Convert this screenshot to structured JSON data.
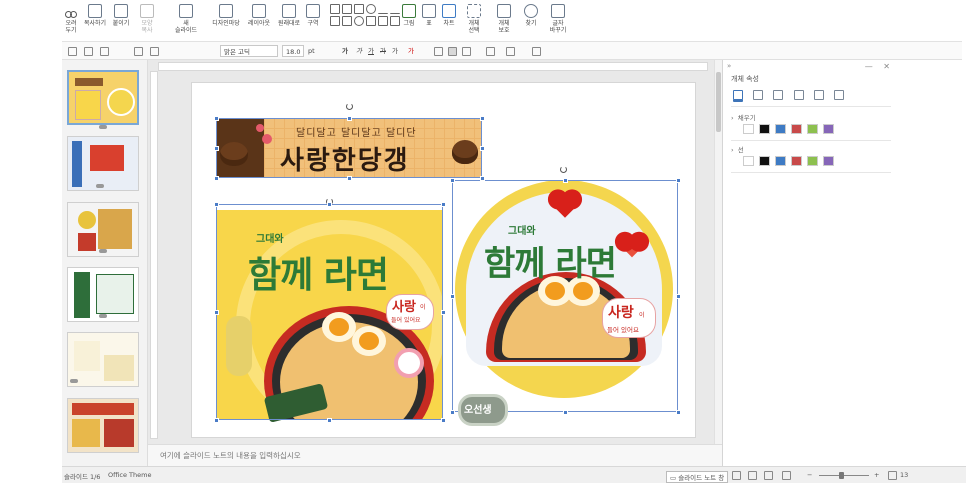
{
  "ribbon": {
    "clipboard": [
      {
        "label": "오려\n두기",
        "icon": "scissors-icon"
      },
      {
        "label": "복사하기",
        "icon": "copy-icon"
      },
      {
        "label": "붙이기",
        "icon": "paste-icon"
      },
      {
        "label": "모양\n복사",
        "icon": "format-painter-icon",
        "disabled": true
      }
    ],
    "slide": [
      {
        "label": "새\n슬라이드",
        "icon": "new-slide-icon"
      },
      {
        "label": "디자인마당",
        "icon": "design-icon"
      },
      {
        "label": "레이아웃",
        "icon": "layout-icon"
      },
      {
        "label": "원래대로",
        "icon": "reset-icon"
      },
      {
        "label": "구역",
        "icon": "section-icon"
      }
    ],
    "insert": [
      {
        "label": "그림",
        "icon": "picture-icon"
      },
      {
        "label": "표",
        "icon": "table-icon"
      },
      {
        "label": "차트",
        "icon": "chart-icon"
      },
      {
        "label": "개체\n선택",
        "icon": "select-object-icon"
      },
      {
        "label": "개체\n보호",
        "icon": "protect-object-icon"
      },
      {
        "label": "찾기",
        "icon": "find-icon"
      },
      {
        "label": "글자\n바꾸기",
        "icon": "replace-icon"
      }
    ]
  },
  "format_bar": {
    "font_name": "맑은 고딕",
    "font_size": "18.0",
    "font_unit": "pt",
    "bold": "가",
    "italic": "가",
    "underline": "가",
    "strike": "가",
    "superscript": "가",
    "color_a": "가"
  },
  "thumbnails": [
    {
      "index": 1,
      "selected": true,
      "bg": "#f6d26a"
    },
    {
      "index": 2,
      "selected": false,
      "bg": "#e9eef6"
    },
    {
      "index": 3,
      "selected": false,
      "bg": "#f4f4f4"
    },
    {
      "index": 4,
      "selected": false,
      "bg": "#ffffff"
    },
    {
      "index": 5,
      "selected": false,
      "bg": "#fbf7ea"
    },
    {
      "index": 6,
      "selected": false,
      "bg": "#f2e3c8"
    }
  ],
  "slide": {
    "banner": {
      "subtitle": "달디달고 달디달고 달디단",
      "title": "사랑한당갱"
    },
    "poster_square": {
      "top_text": "그대와",
      "headline": "함께 라면",
      "bubble_big": "사랑",
      "bubble_small_1": "이",
      "bubble_small_2": "들어 있어요"
    },
    "poster_circle": {
      "top_text": "그대와",
      "headline": "함께 라면",
      "bubble_big": "사랑",
      "bubble_small_1": "이",
      "bubble_small_2": "들어 있어요"
    },
    "stamp_text": "오선생"
  },
  "notes_placeholder": "여기에 슬라이드 노트의 내용을 입력하십시오",
  "right_panel": {
    "header_left": "»",
    "header_right": "— ✕",
    "title": "개체 속성",
    "fill_label": "채우기",
    "line_label": "선",
    "swatches": [
      "#ffffff",
      "#111111",
      "#3e7bc4",
      "#c84a4a",
      "#8dc04f",
      "#8666b8"
    ]
  },
  "status_bar": {
    "slide_counter": "슬라이드 1/6",
    "theme": "Office Theme",
    "notes_button": "슬라이드 노트 창",
    "zoom": "13"
  },
  "colors": {
    "selection_blue": "#4a7cc7",
    "accent_yellow": "#f8d64a",
    "headline_green": "#2d7a37",
    "heart_red": "#d8201a"
  }
}
